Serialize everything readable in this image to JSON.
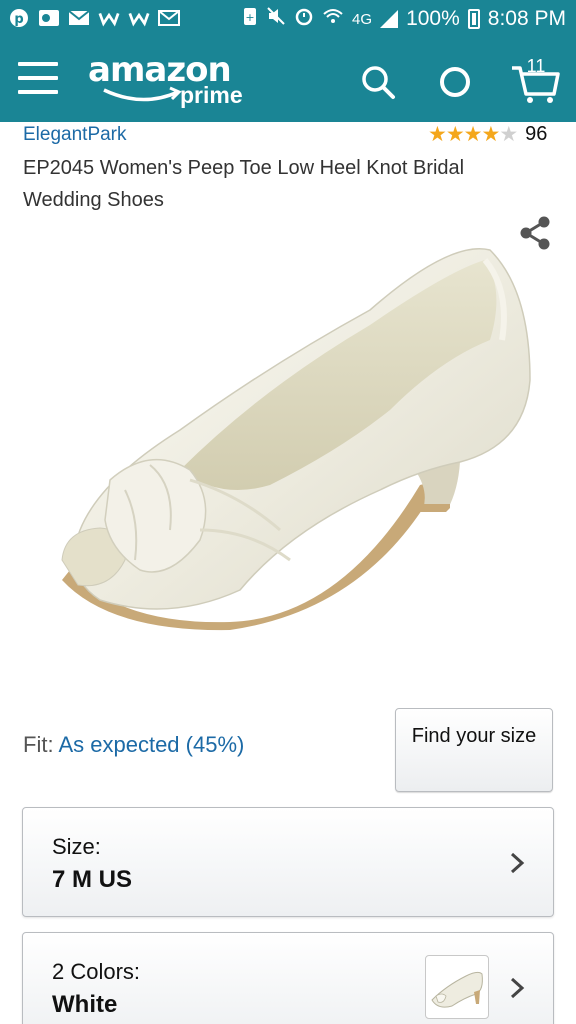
{
  "status_bar": {
    "network": "4G",
    "battery": "100%",
    "time": "8:08 PM",
    "notification_icons": [
      "pinterest-icon",
      "outlook-icon",
      "gmail-icon",
      "w-app-icon",
      "w-app-icon",
      "email-icon"
    ],
    "system_icons": [
      "battery-saver-icon",
      "mute-icon",
      "alarm-icon",
      "wifi-icon",
      "signal-icon"
    ]
  },
  "header": {
    "logo_word": "amazon",
    "logo_sub": "prime",
    "cart_count": "11",
    "background": "#1a8595"
  },
  "product": {
    "brand": "ElegantPark",
    "rating_stars": 4,
    "rating_max": 5,
    "rating_count": "96",
    "title": "EP2045 Women's Peep Toe Low Heel Knot Bridal Wedding Shoes"
  },
  "fit": {
    "label": "Fit:",
    "value": "As expected (45%)"
  },
  "find_size_button": "Find your size",
  "size_selector": {
    "label": "Size:",
    "value": "7 M US"
  },
  "color_selector": {
    "label": "2 Colors:",
    "value": "White"
  },
  "colors": {
    "link": "#1c6aa6",
    "star": "#f4a71c"
  }
}
